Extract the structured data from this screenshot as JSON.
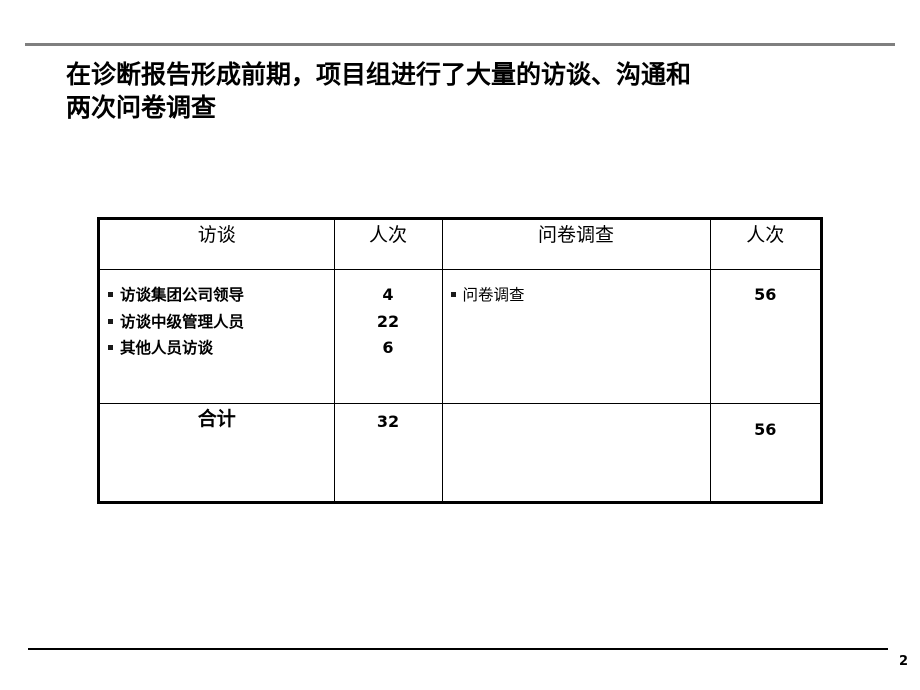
{
  "slide": {
    "page_number": "2",
    "title": "在诊断报告形成前期，项目组进行了大量的访谈、沟通和\n两次问卷调查"
  },
  "table": {
    "headers": {
      "col1": "访谈",
      "col2": "人次",
      "col3": "问卷调查",
      "col4": "人次"
    },
    "interviews": [
      {
        "label": "访谈集团公司领导",
        "count": "4"
      },
      {
        "label": "访谈中级管理人员",
        "count": "22"
      },
      {
        "label": "其他人员访谈",
        "count": "6"
      }
    ],
    "surveys": [
      {
        "label": "问卷调查",
        "count": "56"
      }
    ],
    "total": {
      "label": "合计",
      "interview_total": "32",
      "survey_label": "",
      "survey_total": "56"
    }
  },
  "colors": {
    "top_rule": "#7f7f7f",
    "bottom_rule": "#000000",
    "text": "#000000",
    "table_border": "#000000"
  }
}
